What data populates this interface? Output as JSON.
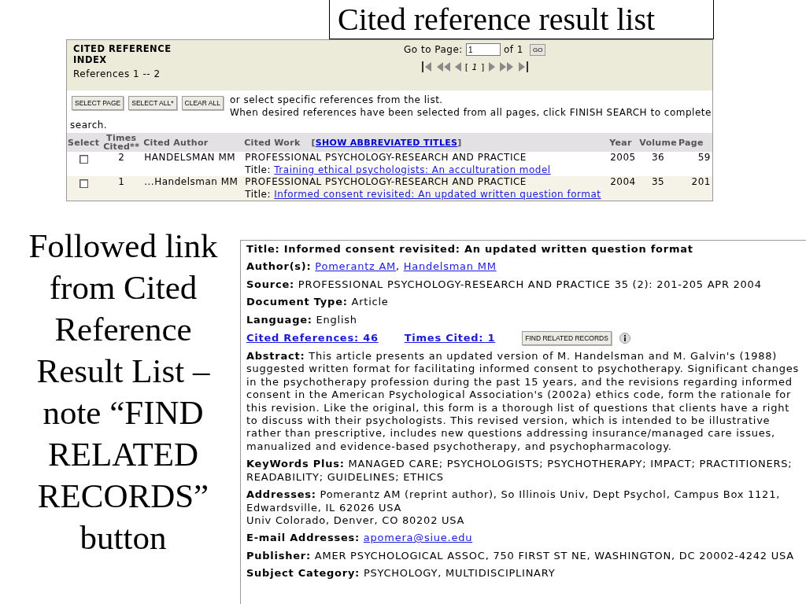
{
  "slide_title": "Cited reference result list",
  "caption": "Followed link from Cited Reference Result List – note “FIND RELATED RECORDS” button",
  "cited_index": {
    "heading": "CITED REFERENCE INDEX",
    "range": "References 1 -- 2",
    "goto_label": "Go to Page:",
    "page_value": "1",
    "of_label": "of 1",
    "go_button": "GO",
    "pager_current": "[ *1* ]",
    "buttons": [
      "SELECT PAGE",
      "SELECT ALL*",
      "CLEAR ALL"
    ],
    "instructions": [
      "or select specific references from the list.",
      "When desired references have been selected from all pages, click FINISH SEARCH to complete",
      "search."
    ],
    "columns": [
      "Select",
      "Times Cited**",
      "Cited Author",
      "Cited Work",
      "Year",
      "Volume",
      "Page"
    ],
    "abbrev_link": "SHOW ABBREVIATED TITLES",
    "abbrev_open": "[",
    "abbrev_close": "]",
    "rows": [
      {
        "checked": false,
        "times_cited": "2",
        "author": "HANDELSMAN MM",
        "work": "PROFESSIONAL PSYCHOLOGY-RESEARCH AND PRACTICE",
        "title_label": "Title:",
        "title_link": "Training ethical psychologists: An acculturation model",
        "year": "2005",
        "volume": "36",
        "page": "59"
      },
      {
        "checked": false,
        "times_cited": "1",
        "author": "...Handelsman MM",
        "work": "PROFESSIONAL PSYCHOLOGY-RESEARCH AND PRACTICE",
        "title_label": "Title:",
        "title_link": "Informed consent revisited: An updated written question format",
        "year": "2004",
        "volume": "35",
        "page": "201"
      }
    ]
  },
  "record": {
    "fields": [
      {
        "kind": "title",
        "label": "Title:",
        "value": "Informed consent revisited: An updated written question format"
      },
      {
        "kind": "links",
        "label": "Author(s):",
        "links": [
          "Pomerantz AM",
          "Handelsman MM"
        ],
        "separator": ","
      },
      {
        "kind": "text",
        "label": "Source:",
        "value": "PROFESSIONAL PSYCHOLOGY-RESEARCH AND PRACTICE 35 (2): 201-205 APR 2004"
      },
      {
        "kind": "text",
        "label": "Document Type:",
        "value": "Article"
      },
      {
        "kind": "text",
        "label": "Language:",
        "value": "English"
      },
      {
        "kind": "citations",
        "cited_references": "Cited References: 46",
        "times_cited": "Times Cited: 1",
        "button": "FIND RELATED RECORDS"
      },
      {
        "kind": "text",
        "label": "Abstract:",
        "value": "This article presents an updated version of M. Handelsman and M. Galvin's (1988) suggested written format for facilitating informed consent to psychotherapy. Significant changes in the psychotherapy profession during the past 15 years, and the revisions regarding informed consent in the American Psychological Association's (2002a) ethics code, form the rationale for this revision. Like the original, this form is a thorough list of questions that clients have a right to discuss with their psychologists. This revised version, which is intended to be illustrative rather than prescriptive, includes new questions addressing insurance/managed care issues, manualized and evidence-based psychotherapy, and psychopharmacology."
      },
      {
        "kind": "text",
        "label": "KeyWords Plus:",
        "value": "MANAGED CARE; PSYCHOLOGISTS; PSYCHOTHERAPY; IMPACT; PRACTITIONERS; READABILITY; GUIDELINES; ETHICS"
      },
      {
        "kind": "text",
        "label": "Addresses:",
        "value": "Pomerantz AM (reprint author), So Illinois Univ, Dept Psychol, Campus Box 1121, Edwardsville, IL 62026 USA\nUniv Colorado, Denver, CO 80202 USA"
      },
      {
        "kind": "links",
        "label": "E-mail Addresses:",
        "links": [
          "apomera@siue.edu"
        ]
      },
      {
        "kind": "text",
        "label": "Publisher:",
        "value": "AMER PSYCHOLOGICAL ASSOC, 750 FIRST ST NE, WASHINGTON, DC 20002-4242 USA"
      },
      {
        "kind": "text",
        "label": "Subject Category:",
        "value": "PSYCHOLOGY, MULTIDISCIPLINARY"
      }
    ]
  }
}
